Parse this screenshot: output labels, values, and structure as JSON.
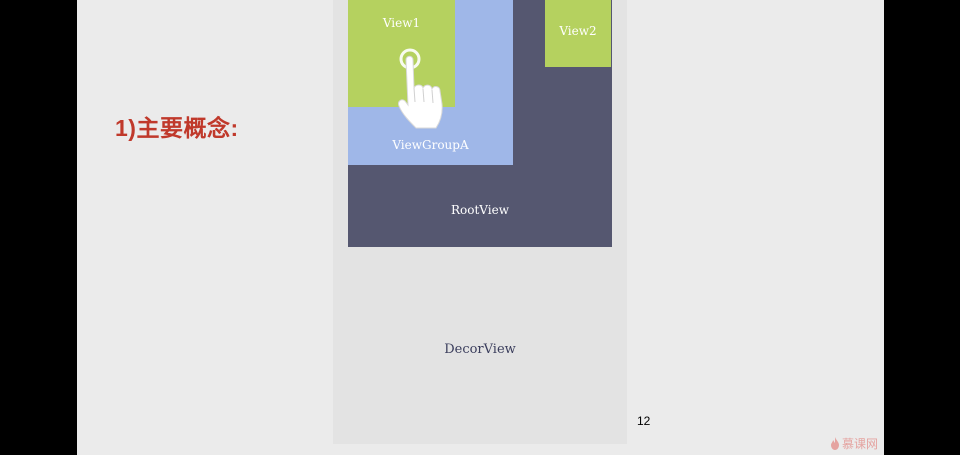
{
  "slide": {
    "heading": "1)主要概念:",
    "page_number": "12",
    "watermark": "慕课网"
  },
  "diagram": {
    "decor_view": "DecorView",
    "root_view": "RootView",
    "view_group_a": "ViewGroupA",
    "view1": "View1",
    "view2": "View2"
  },
  "colors": {
    "heading": "#c0392b",
    "decor": "#e3e3e3",
    "root": "#555770",
    "group": "#9fb7e8",
    "view": "#b5d15f"
  },
  "icons": {
    "touch": "tap-hand-icon",
    "logo": "flame-icon"
  }
}
